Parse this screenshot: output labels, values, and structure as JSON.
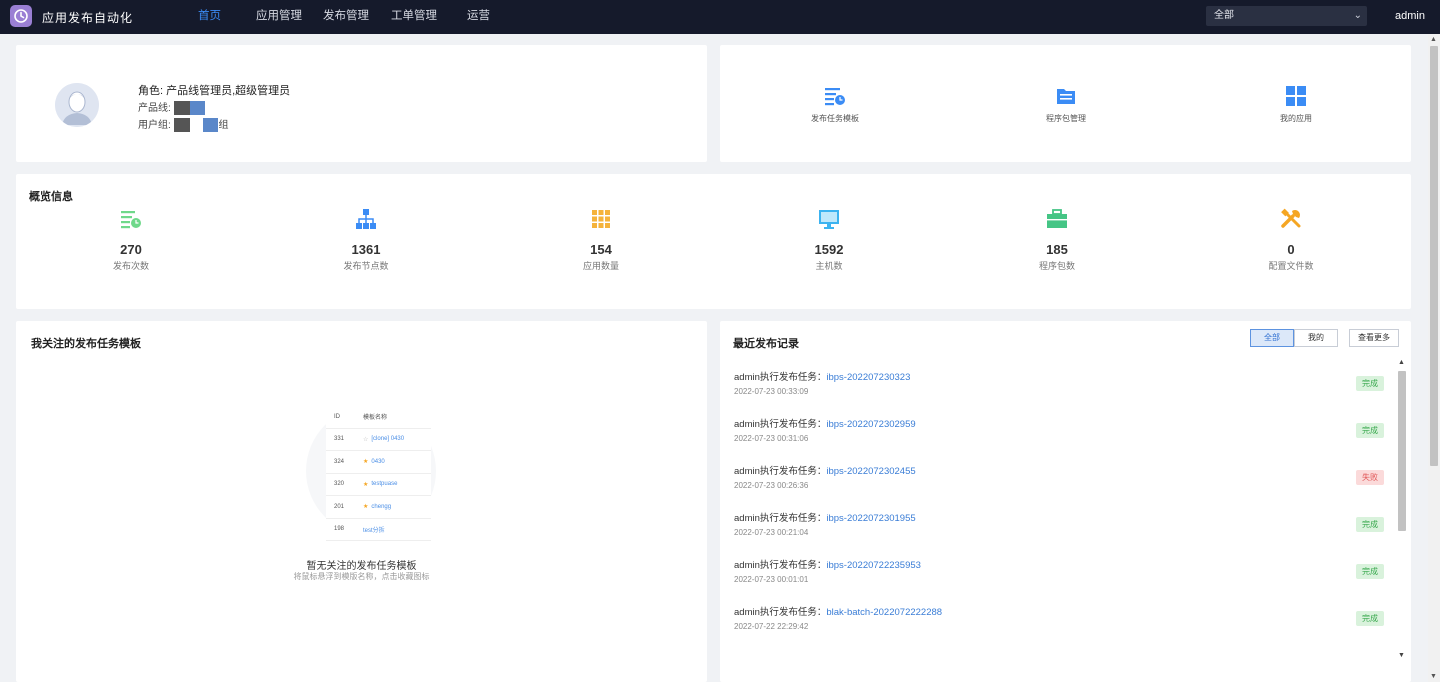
{
  "app": {
    "title": "应用发布自动化"
  },
  "nav": {
    "items": [
      "首页",
      "应用管理",
      "发布管理",
      "工单管理",
      "运营"
    ],
    "active": "首页"
  },
  "header": {
    "scope_value": "全部",
    "user": "admin"
  },
  "profile": {
    "role_label": "角色: 产品线管理员,超级管理员",
    "product_line_label": "产品线:",
    "product_line_tail": "",
    "user_group_label": "用户组:",
    "user_group_tail": "组"
  },
  "quick_links": [
    {
      "label": "发布任务模板",
      "icon": "task-template-icon"
    },
    {
      "label": "程序包管理",
      "icon": "package-folder-icon"
    },
    {
      "label": "我的应用",
      "icon": "apps-grid-icon"
    }
  ],
  "overview": {
    "title": "概览信息",
    "stats": [
      {
        "value": "270",
        "label": "发布次数",
        "icon": "release-list-icon",
        "color": "#6fd88a"
      },
      {
        "value": "1361",
        "label": "发布节点数",
        "icon": "node-tree-icon",
        "color": "#3b8cf5"
      },
      {
        "value": "154",
        "label": "应用数量",
        "icon": "grid-dots-icon",
        "color": "#f5b33b"
      },
      {
        "value": "1592",
        "label": "主机数",
        "icon": "monitor-icon",
        "color": "#3cb3f0"
      },
      {
        "value": "185",
        "label": "程序包数",
        "icon": "briefcase-icon",
        "color": "#45c585"
      },
      {
        "value": "0",
        "label": "配置文件数",
        "icon": "tools-icon",
        "color": "#f5a623"
      }
    ]
  },
  "followed": {
    "title": "我关注的发布任务模板",
    "illustration": {
      "headers": [
        "ID",
        "模板名称"
      ],
      "rows": [
        {
          "id": "331",
          "name": "[clone] 0430",
          "starred": false
        },
        {
          "id": "324",
          "name": "0430",
          "starred": true
        },
        {
          "id": "320",
          "name": "testpuase",
          "starred": true
        },
        {
          "id": "201",
          "name": "chengg",
          "starred": true
        },
        {
          "id": "198",
          "name": "test分拆",
          "starred": false
        }
      ]
    },
    "empty_title": "暂无关注的发布任务模板",
    "empty_hint": "将鼠标悬浮到模版名称，点击收藏图标"
  },
  "recent": {
    "title": "最近发布记录",
    "filters": [
      "全部",
      "我的"
    ],
    "active_filter": "全部",
    "more_label": "查看更多",
    "records": [
      {
        "prefix": "admin执行发布任务：",
        "task": "ibps-202207230323",
        "time": "2022-07-23 00:33:09",
        "status": "完成",
        "status_type": "ok"
      },
      {
        "prefix": "admin执行发布任务：",
        "task": "ibps-2022072302959",
        "time": "2022-07-23 00:31:06",
        "status": "完成",
        "status_type": "ok"
      },
      {
        "prefix": "admin执行发布任务：",
        "task": "ibps-2022072302455",
        "time": "2022-07-23 00:26:36",
        "status": "失败",
        "status_type": "fail"
      },
      {
        "prefix": "admin执行发布任务：",
        "task": "ibps-2022072301955",
        "time": "2022-07-23 00:21:04",
        "status": "完成",
        "status_type": "ok"
      },
      {
        "prefix": "admin执行发布任务：",
        "task": "ibps-20220722235953",
        "time": "2022-07-23 00:01:01",
        "status": "完成",
        "status_type": "ok"
      },
      {
        "prefix": "admin执行发布任务：",
        "task": "blak-batch-2022072222288",
        "time": "2022-07-22 22:29:42",
        "status": "完成",
        "status_type": "ok"
      }
    ]
  }
}
